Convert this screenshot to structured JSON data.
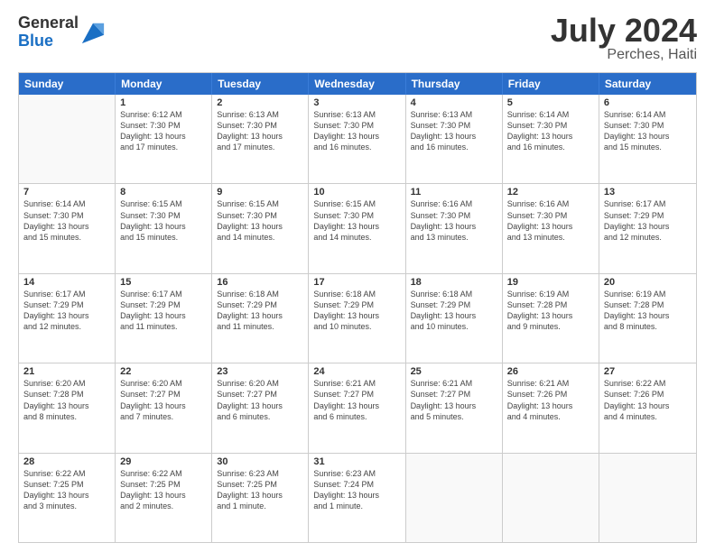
{
  "logo": {
    "line1": "General",
    "line2": "Blue"
  },
  "title": "July 2024",
  "subtitle": "Perches, Haiti",
  "days": [
    "Sunday",
    "Monday",
    "Tuesday",
    "Wednesday",
    "Thursday",
    "Friday",
    "Saturday"
  ],
  "rows": [
    [
      {
        "day": "",
        "sunrise": "",
        "sunset": "",
        "daylight": ""
      },
      {
        "day": "1",
        "sunrise": "6:12 AM",
        "sunset": "7:30 PM",
        "daylight": "13 hours and 17 minutes."
      },
      {
        "day": "2",
        "sunrise": "6:13 AM",
        "sunset": "7:30 PM",
        "daylight": "13 hours and 17 minutes."
      },
      {
        "day": "3",
        "sunrise": "6:13 AM",
        "sunset": "7:30 PM",
        "daylight": "13 hours and 16 minutes."
      },
      {
        "day": "4",
        "sunrise": "6:13 AM",
        "sunset": "7:30 PM",
        "daylight": "13 hours and 16 minutes."
      },
      {
        "day": "5",
        "sunrise": "6:14 AM",
        "sunset": "7:30 PM",
        "daylight": "13 hours and 16 minutes."
      },
      {
        "day": "6",
        "sunrise": "6:14 AM",
        "sunset": "7:30 PM",
        "daylight": "13 hours and 15 minutes."
      }
    ],
    [
      {
        "day": "7",
        "sunrise": "6:14 AM",
        "sunset": "7:30 PM",
        "daylight": "13 hours and 15 minutes."
      },
      {
        "day": "8",
        "sunrise": "6:15 AM",
        "sunset": "7:30 PM",
        "daylight": "13 hours and 15 minutes."
      },
      {
        "day": "9",
        "sunrise": "6:15 AM",
        "sunset": "7:30 PM",
        "daylight": "13 hours and 14 minutes."
      },
      {
        "day": "10",
        "sunrise": "6:15 AM",
        "sunset": "7:30 PM",
        "daylight": "13 hours and 14 minutes."
      },
      {
        "day": "11",
        "sunrise": "6:16 AM",
        "sunset": "7:30 PM",
        "daylight": "13 hours and 13 minutes."
      },
      {
        "day": "12",
        "sunrise": "6:16 AM",
        "sunset": "7:30 PM",
        "daylight": "13 hours and 13 minutes."
      },
      {
        "day": "13",
        "sunrise": "6:17 AM",
        "sunset": "7:29 PM",
        "daylight": "13 hours and 12 minutes."
      }
    ],
    [
      {
        "day": "14",
        "sunrise": "6:17 AM",
        "sunset": "7:29 PM",
        "daylight": "13 hours and 12 minutes."
      },
      {
        "day": "15",
        "sunrise": "6:17 AM",
        "sunset": "7:29 PM",
        "daylight": "13 hours and 11 minutes."
      },
      {
        "day": "16",
        "sunrise": "6:18 AM",
        "sunset": "7:29 PM",
        "daylight": "13 hours and 11 minutes."
      },
      {
        "day": "17",
        "sunrise": "6:18 AM",
        "sunset": "7:29 PM",
        "daylight": "13 hours and 10 minutes."
      },
      {
        "day": "18",
        "sunrise": "6:18 AM",
        "sunset": "7:29 PM",
        "daylight": "13 hours and 10 minutes."
      },
      {
        "day": "19",
        "sunrise": "6:19 AM",
        "sunset": "7:28 PM",
        "daylight": "13 hours and 9 minutes."
      },
      {
        "day": "20",
        "sunrise": "6:19 AM",
        "sunset": "7:28 PM",
        "daylight": "13 hours and 8 minutes."
      }
    ],
    [
      {
        "day": "21",
        "sunrise": "6:20 AM",
        "sunset": "7:28 PM",
        "daylight": "13 hours and 8 minutes."
      },
      {
        "day": "22",
        "sunrise": "6:20 AM",
        "sunset": "7:27 PM",
        "daylight": "13 hours and 7 minutes."
      },
      {
        "day": "23",
        "sunrise": "6:20 AM",
        "sunset": "7:27 PM",
        "daylight": "13 hours and 6 minutes."
      },
      {
        "day": "24",
        "sunrise": "6:21 AM",
        "sunset": "7:27 PM",
        "daylight": "13 hours and 6 minutes."
      },
      {
        "day": "25",
        "sunrise": "6:21 AM",
        "sunset": "7:27 PM",
        "daylight": "13 hours and 5 minutes."
      },
      {
        "day": "26",
        "sunrise": "6:21 AM",
        "sunset": "7:26 PM",
        "daylight": "13 hours and 4 minutes."
      },
      {
        "day": "27",
        "sunrise": "6:22 AM",
        "sunset": "7:26 PM",
        "daylight": "13 hours and 4 minutes."
      }
    ],
    [
      {
        "day": "28",
        "sunrise": "6:22 AM",
        "sunset": "7:25 PM",
        "daylight": "13 hours and 3 minutes."
      },
      {
        "day": "29",
        "sunrise": "6:22 AM",
        "sunset": "7:25 PM",
        "daylight": "13 hours and 2 minutes."
      },
      {
        "day": "30",
        "sunrise": "6:23 AM",
        "sunset": "7:25 PM",
        "daylight": "13 hours and 1 minute."
      },
      {
        "day": "31",
        "sunrise": "6:23 AM",
        "sunset": "7:24 PM",
        "daylight": "13 hours and 1 minute."
      },
      {
        "day": "",
        "sunrise": "",
        "sunset": "",
        "daylight": ""
      },
      {
        "day": "",
        "sunrise": "",
        "sunset": "",
        "daylight": ""
      },
      {
        "day": "",
        "sunrise": "",
        "sunset": "",
        "daylight": ""
      }
    ]
  ]
}
